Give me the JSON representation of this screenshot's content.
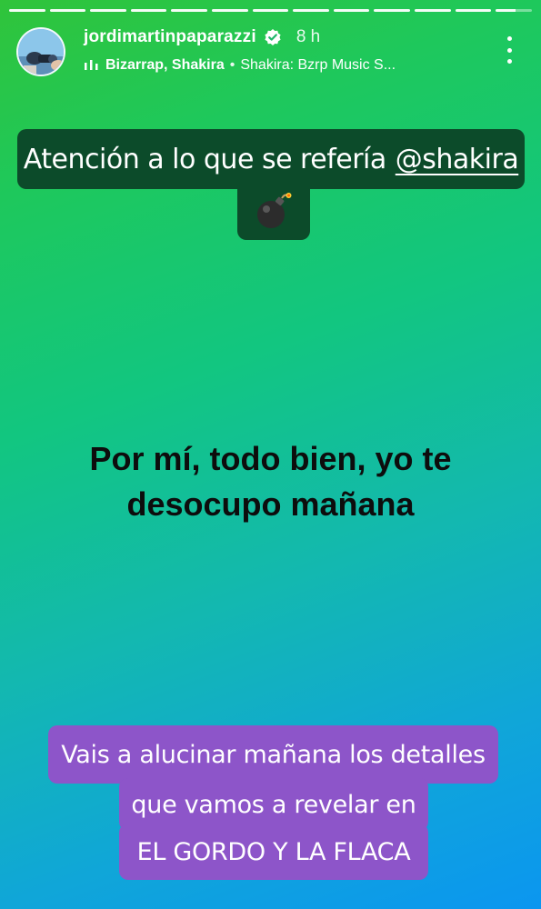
{
  "story": {
    "progress_segments": 13,
    "progress_completed": 12,
    "current_segment_progress": 0.55
  },
  "header": {
    "username": "jordimartinpaparazzi",
    "time_ago": "8 h",
    "verified": true,
    "music_artists": "Bizarrap, Shakira",
    "music_separator": "•",
    "music_track": "Shakira: Bzrp Music S...",
    "avatar_icon": "avatar-photo",
    "more_icon": "more-vertical-icon"
  },
  "caption_top": {
    "text": "Atención a lo que se refería",
    "mention": "@shakira",
    "emoji": "bomb",
    "background": "#0c4b2a"
  },
  "middle_text": {
    "line1": "Por mí, todo bien, yo te",
    "line2": "desocupo mañana"
  },
  "caption_bottom": {
    "line1": "Vais a alucinar mañana los detalles",
    "line2": "que vamos a revelar en",
    "line3": "EL GORDO Y LA FLACA",
    "background": "#8d55c9"
  },
  "colors": {
    "gradient_top": "#30c43a",
    "gradient_mid": "#12c680",
    "gradient_bottom": "#0b96f0"
  }
}
